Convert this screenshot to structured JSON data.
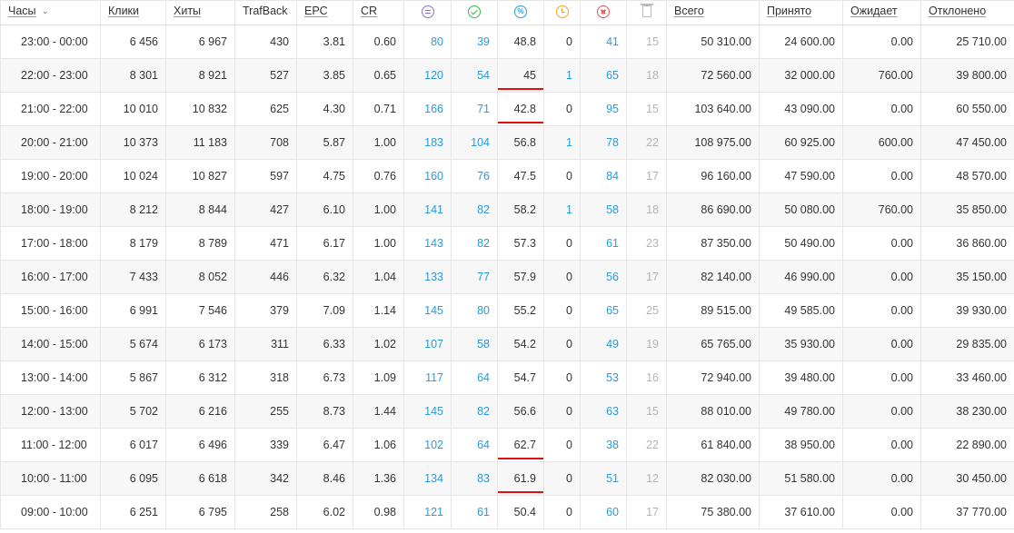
{
  "headers": {
    "hours": "Часы",
    "clicks": "Клики",
    "hits": "Хиты",
    "trafback": "TrafBack",
    "epc": "EPC",
    "cr": "CR",
    "icon_total": "total-icon",
    "icon_approved": "check-circle-icon",
    "icon_percent": "percent-icon",
    "icon_hold": "clock-icon",
    "icon_rejected": "x-circle-icon",
    "icon_trash": "trash-icon",
    "sum_total": "Всего",
    "sum_accepted": "Принято",
    "sum_pending": "Ожидает",
    "sum_rejected": "Отклонено"
  },
  "colors": {
    "link": "#2a9ad8",
    "muted": "#b3b3b3",
    "highlight_mark": "#e01010"
  },
  "rows": [
    {
      "hour": "23:00 - 00:00",
      "clicks": "6 456",
      "hits": "6 967",
      "trafback": "430",
      "epc": "3.81",
      "cr": "0.60",
      "total": "80",
      "approved": "39",
      "percent": "48.8",
      "hold": "0",
      "rejected": "41",
      "trash": "15",
      "sum_total": "50 310.00",
      "sum_accepted": "24 600.00",
      "sum_pending": "0.00",
      "sum_rejected": "25 710.00"
    },
    {
      "hour": "22:00 - 23:00",
      "clicks": "8 301",
      "hits": "8 921",
      "trafback": "527",
      "epc": "3.85",
      "cr": "0.65",
      "total": "120",
      "approved": "54",
      "percent": "45",
      "hold": "1",
      "rejected": "65",
      "trash": "18",
      "sum_total": "72 560.00",
      "sum_accepted": "32 000.00",
      "sum_pending": "760.00",
      "sum_rejected": "39 800.00",
      "marked": true
    },
    {
      "hour": "21:00 - 22:00",
      "clicks": "10 010",
      "hits": "10 832",
      "trafback": "625",
      "epc": "4.30",
      "cr": "0.71",
      "total": "166",
      "approved": "71",
      "percent": "42.8",
      "hold": "0",
      "rejected": "95",
      "trash": "15",
      "sum_total": "103 640.00",
      "sum_accepted": "43 090.00",
      "sum_pending": "0.00",
      "sum_rejected": "60 550.00",
      "marked": true
    },
    {
      "hour": "20:00 - 21:00",
      "clicks": "10 373",
      "hits": "11 183",
      "trafback": "708",
      "epc": "5.87",
      "cr": "1.00",
      "total": "183",
      "approved": "104",
      "percent": "56.8",
      "hold": "1",
      "rejected": "78",
      "trash": "22",
      "sum_total": "108 975.00",
      "sum_accepted": "60 925.00",
      "sum_pending": "600.00",
      "sum_rejected": "47 450.00"
    },
    {
      "hour": "19:00 - 20:00",
      "clicks": "10 024",
      "hits": "10 827",
      "trafback": "597",
      "epc": "4.75",
      "cr": "0.76",
      "total": "160",
      "approved": "76",
      "percent": "47.5",
      "hold": "0",
      "rejected": "84",
      "trash": "17",
      "sum_total": "96 160.00",
      "sum_accepted": "47 590.00",
      "sum_pending": "0.00",
      "sum_rejected": "48 570.00"
    },
    {
      "hour": "18:00 - 19:00",
      "clicks": "8 212",
      "hits": "8 844",
      "trafback": "427",
      "epc": "6.10",
      "cr": "1.00",
      "total": "141",
      "approved": "82",
      "percent": "58.2",
      "hold": "1",
      "rejected": "58",
      "trash": "18",
      "sum_total": "86 690.00",
      "sum_accepted": "50 080.00",
      "sum_pending": "760.00",
      "sum_rejected": "35 850.00"
    },
    {
      "hour": "17:00 - 18:00",
      "clicks": "8 179",
      "hits": "8 789",
      "trafback": "471",
      "epc": "6.17",
      "cr": "1.00",
      "total": "143",
      "approved": "82",
      "percent": "57.3",
      "hold": "0",
      "rejected": "61",
      "trash": "23",
      "sum_total": "87 350.00",
      "sum_accepted": "50 490.00",
      "sum_pending": "0.00",
      "sum_rejected": "36 860.00"
    },
    {
      "hour": "16:00 - 17:00",
      "clicks": "7 433",
      "hits": "8 052",
      "trafback": "446",
      "epc": "6.32",
      "cr": "1.04",
      "total": "133",
      "approved": "77",
      "percent": "57.9",
      "hold": "0",
      "rejected": "56",
      "trash": "17",
      "sum_total": "82 140.00",
      "sum_accepted": "46 990.00",
      "sum_pending": "0.00",
      "sum_rejected": "35 150.00"
    },
    {
      "hour": "15:00 - 16:00",
      "clicks": "6 991",
      "hits": "7 546",
      "trafback": "379",
      "epc": "7.09",
      "cr": "1.14",
      "total": "145",
      "approved": "80",
      "percent": "55.2",
      "hold": "0",
      "rejected": "65",
      "trash": "25",
      "sum_total": "89 515.00",
      "sum_accepted": "49 585.00",
      "sum_pending": "0.00",
      "sum_rejected": "39 930.00"
    },
    {
      "hour": "14:00 - 15:00",
      "clicks": "5 674",
      "hits": "6 173",
      "trafback": "311",
      "epc": "6.33",
      "cr": "1.02",
      "total": "107",
      "approved": "58",
      "percent": "54.2",
      "hold": "0",
      "rejected": "49",
      "trash": "19",
      "sum_total": "65 765.00",
      "sum_accepted": "35 930.00",
      "sum_pending": "0.00",
      "sum_rejected": "29 835.00"
    },
    {
      "hour": "13:00 - 14:00",
      "clicks": "5 867",
      "hits": "6 312",
      "trafback": "318",
      "epc": "6.73",
      "cr": "1.09",
      "total": "117",
      "approved": "64",
      "percent": "54.7",
      "hold": "0",
      "rejected": "53",
      "trash": "16",
      "sum_total": "72 940.00",
      "sum_accepted": "39 480.00",
      "sum_pending": "0.00",
      "sum_rejected": "33 460.00"
    },
    {
      "hour": "12:00 - 13:00",
      "clicks": "5 702",
      "hits": "6 216",
      "trafback": "255",
      "epc": "8.73",
      "cr": "1.44",
      "total": "145",
      "approved": "82",
      "percent": "56.6",
      "hold": "0",
      "rejected": "63",
      "trash": "15",
      "sum_total": "88 010.00",
      "sum_accepted": "49 780.00",
      "sum_pending": "0.00",
      "sum_rejected": "38 230.00"
    },
    {
      "hour": "11:00 - 12:00",
      "clicks": "6 017",
      "hits": "6 496",
      "trafback": "339",
      "epc": "6.47",
      "cr": "1.06",
      "total": "102",
      "approved": "64",
      "percent": "62.7",
      "hold": "0",
      "rejected": "38",
      "trash": "22",
      "sum_total": "61 840.00",
      "sum_accepted": "38 950.00",
      "sum_pending": "0.00",
      "sum_rejected": "22 890.00",
      "marked": true
    },
    {
      "hour": "10:00 - 11:00",
      "clicks": "6 095",
      "hits": "6 618",
      "trafback": "342",
      "epc": "8.46",
      "cr": "1.36",
      "total": "134",
      "approved": "83",
      "percent": "61.9",
      "hold": "0",
      "rejected": "51",
      "trash": "12",
      "sum_total": "82 030.00",
      "sum_accepted": "51 580.00",
      "sum_pending": "0.00",
      "sum_rejected": "30 450.00",
      "marked": true
    },
    {
      "hour": "09:00 - 10:00",
      "clicks": "6 251",
      "hits": "6 795",
      "trafback": "258",
      "epc": "6.02",
      "cr": "0.98",
      "total": "121",
      "approved": "61",
      "percent": "50.4",
      "hold": "0",
      "rejected": "60",
      "trash": "17",
      "sum_total": "75 380.00",
      "sum_accepted": "37 610.00",
      "sum_pending": "0.00",
      "sum_rejected": "37 770.00"
    }
  ]
}
